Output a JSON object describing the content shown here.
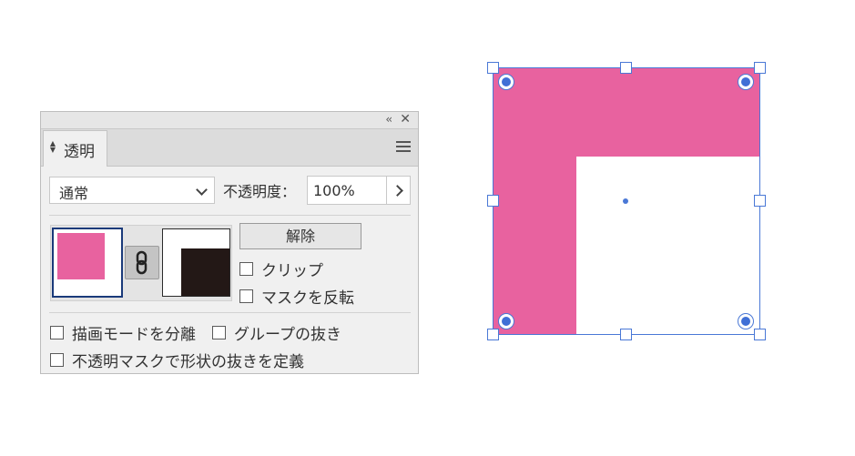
{
  "panel": {
    "tab_label": "透明",
    "collapse_glyph": "‹‹",
    "close_glyph": "✕",
    "blend_mode": "通常",
    "opacity_label": "不透明度：",
    "opacity_value": "100%",
    "release_label": "解除",
    "clip_label": "クリップ",
    "invert_mask_label": "マスクを反転",
    "isolate_blending_label": "描画モードを分離",
    "knockout_group_label": "グループの抜き",
    "opacity_mask_knockout_label": "不透明マスクで形状の抜きを定義"
  },
  "colors": {
    "artwork_pink": "#e8629f",
    "mask_dark": "#231816",
    "selection_blue": "#4a78d6"
  }
}
